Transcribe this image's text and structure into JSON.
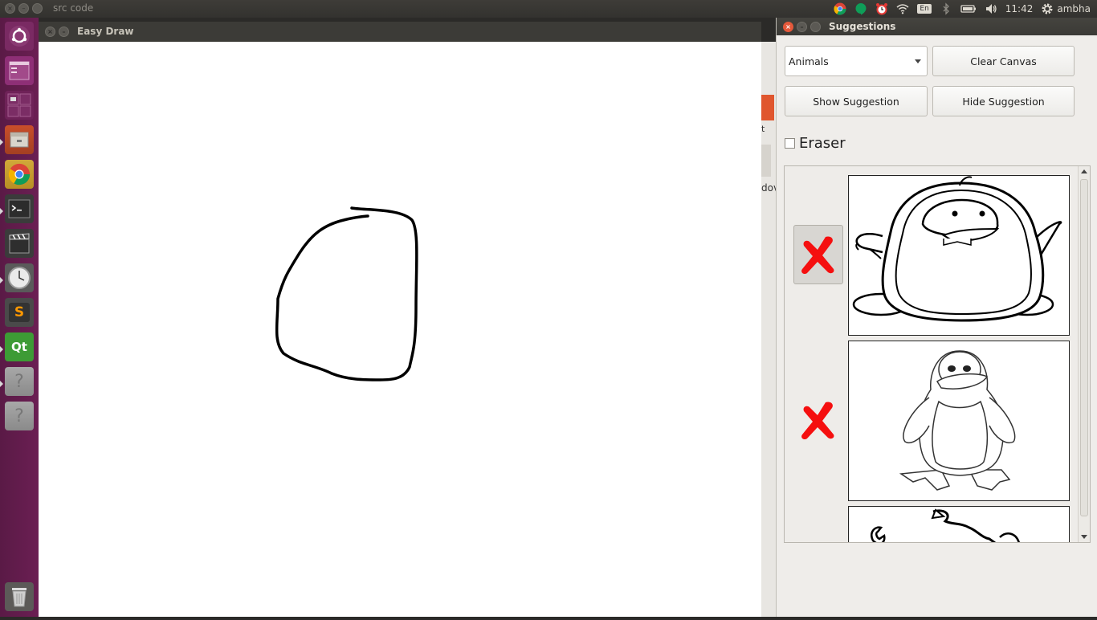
{
  "top_panel": {
    "title": "src code",
    "keyboard_layout": "En",
    "time": "11:42",
    "user": "ambha"
  },
  "launcher": {
    "items": [
      {
        "name": "ubuntu-dash-icon"
      },
      {
        "name": "workspace-app-icon"
      },
      {
        "name": "workspace-switcher-icon"
      },
      {
        "name": "files-icon"
      },
      {
        "name": "chrome-icon"
      },
      {
        "name": "terminal-icon"
      },
      {
        "name": "video-editor-icon"
      },
      {
        "name": "clock-icon"
      },
      {
        "name": "sublime-text-icon",
        "glyph": "S"
      },
      {
        "name": "qt-creator-icon",
        "glyph": "Qt"
      },
      {
        "name": "unknown-app-icon",
        "glyph": "?"
      },
      {
        "name": "unknown-app-icon",
        "glyph": "?"
      },
      {
        "name": "trash-icon"
      }
    ]
  },
  "easy_draw": {
    "title": "Easy Draw"
  },
  "background_window": {
    "partial_text_1": "t",
    "partial_text_2": "dov"
  },
  "suggestions": {
    "title": "Suggestions",
    "category_select": {
      "selected": "Animals"
    },
    "clear_canvas_label": "Clear Canvas",
    "show_suggestion_label": "Show Suggestion",
    "hide_suggestion_label": "Hide Suggestion",
    "eraser_label": "Eraser",
    "eraser_checked": false,
    "items": [
      {
        "image": "penguin-cartoon",
        "delete_icon": "red-x-icon",
        "delete_highlighted": true
      },
      {
        "image": "penguin-tux",
        "delete_icon": "red-x-icon",
        "delete_highlighted": false
      },
      {
        "image": "scorpion",
        "delete_icon": "red-x-icon",
        "delete_highlighted": false
      }
    ]
  },
  "colors": {
    "launcher": "#5e1b4a",
    "panel": "#3c3b37",
    "close_button": "#e5593b",
    "delete_x": "#ff0000",
    "canvas": "#ffffff"
  }
}
